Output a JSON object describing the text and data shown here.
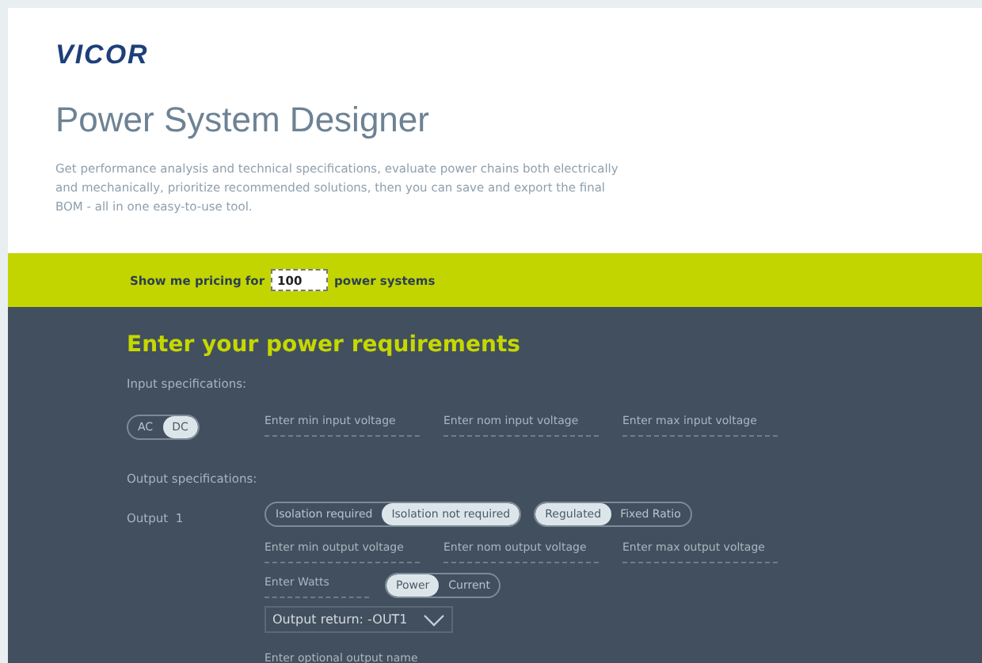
{
  "logo": "VICOR",
  "title": "Power System Designer",
  "description": "Get performance analysis and technical specifications, evaluate power chains both electrically and mechanically, prioritize recommended solutions, then you can save and export the final BOM - all in one easy-to-use tool.",
  "pricing": {
    "prefix": "Show me pricing for",
    "value": "100",
    "suffix": "power systems"
  },
  "requirements": {
    "heading": "Enter your power requirements",
    "input_label": "Input specifications:",
    "input_type": [
      {
        "label": "AC",
        "selected": false
      },
      {
        "label": "DC",
        "selected": true
      }
    ],
    "input_fields": [
      {
        "placeholder": "Enter min input voltage"
      },
      {
        "placeholder": "Enter nom input voltage"
      },
      {
        "placeholder": "Enter max input voltage"
      }
    ],
    "output_label": "Output specifications:",
    "outputs": [
      {
        "name": "Output  1",
        "isolation": [
          {
            "label": "Isolation required",
            "selected": false
          },
          {
            "label": "Isolation not required",
            "selected": true
          }
        ],
        "regulation": [
          {
            "label": "Regulated",
            "selected": true
          },
          {
            "label": "Fixed Ratio",
            "selected": false
          }
        ],
        "voltage_fields": [
          {
            "placeholder": "Enter min output voltage"
          },
          {
            "placeholder": "Enter nom output voltage"
          },
          {
            "placeholder": "Enter max output voltage"
          }
        ],
        "watts_field": {
          "placeholder": "Enter Watts"
        },
        "mode": [
          {
            "label": "Power",
            "selected": true
          },
          {
            "label": "Current",
            "selected": false
          }
        ],
        "return_select": {
          "value": "Output return: -OUT1"
        },
        "name_field": {
          "placeholder": "Enter optional output name"
        }
      }
    ]
  }
}
